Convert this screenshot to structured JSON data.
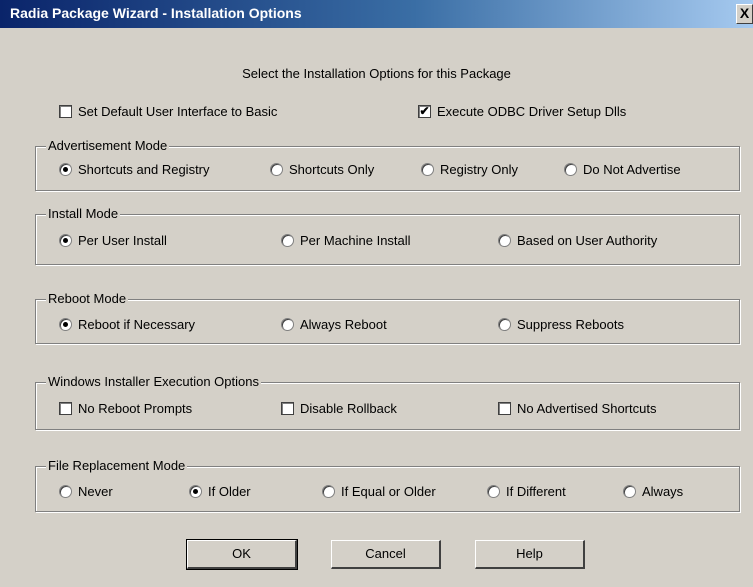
{
  "window": {
    "title": "Radia Package Wizard - Installation Options",
    "close": "X"
  },
  "heading": "Select the Installation Options for this Package",
  "top_options": [
    {
      "label": "Set Default User Interface to Basic",
      "checked": false
    },
    {
      "label": "Execute ODBC Driver Setup Dlls",
      "checked": true
    }
  ],
  "advertisement": {
    "legend": "Advertisement Mode",
    "options": [
      "Shortcuts and Registry",
      "Shortcuts Only",
      "Registry Only",
      "Do Not Advertise"
    ],
    "selected": 0
  },
  "install": {
    "legend": "Install Mode",
    "options": [
      "Per User Install",
      "Per Machine Install",
      "Based on User Authority"
    ],
    "selected": 0
  },
  "reboot": {
    "legend": "Reboot Mode",
    "options": [
      "Reboot if Necessary",
      "Always Reboot",
      "Suppress Reboots"
    ],
    "selected": 0
  },
  "msi_exec": {
    "legend": "Windows Installer Execution Options",
    "options": [
      {
        "label": "No Reboot Prompts",
        "checked": false
      },
      {
        "label": "Disable Rollback",
        "checked": false
      },
      {
        "label": "No Advertised Shortcuts",
        "checked": false
      }
    ]
  },
  "file_replacement": {
    "legend": "File Replacement Mode",
    "options": [
      "Never",
      "If Older",
      "If Equal or Older",
      "If Different",
      "Always"
    ],
    "selected": 1
  },
  "buttons": {
    "ok": "OK",
    "cancel": "Cancel",
    "help": "Help"
  }
}
